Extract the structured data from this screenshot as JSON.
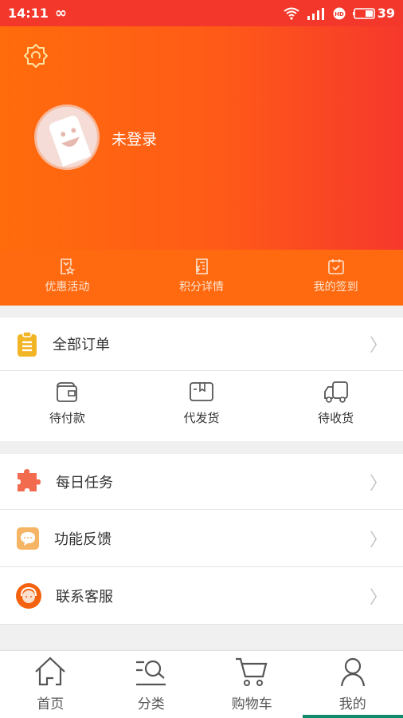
{
  "status_bar": {
    "time": "14:11",
    "battery": "39"
  },
  "profile": {
    "login_status": "未登录"
  },
  "quick_links": [
    {
      "label": "优惠活动",
      "icon": "coupon-icon"
    },
    {
      "label": "积分详情",
      "icon": "points-icon"
    },
    {
      "label": "我的签到",
      "icon": "checkin-icon"
    }
  ],
  "orders": {
    "all_label": "全部订单",
    "states": [
      {
        "label": "待付款",
        "icon": "wallet-icon"
      },
      {
        "label": "代发货",
        "icon": "box-icon"
      },
      {
        "label": "待收货",
        "icon": "truck-icon"
      }
    ]
  },
  "menu": [
    {
      "label": "每日任务",
      "icon": "puzzle-icon",
      "color": "#f26b4f"
    },
    {
      "label": "功能反馈",
      "icon": "feedback-icon",
      "color": "#f6b565"
    },
    {
      "label": "联系客服",
      "icon": "customer-service-icon",
      "color": "#f5620f"
    }
  ],
  "tabs": [
    {
      "label": "首页",
      "icon": "home-icon"
    },
    {
      "label": "分类",
      "icon": "category-icon"
    },
    {
      "label": "购物车",
      "icon": "cart-icon"
    },
    {
      "label": "我的",
      "icon": "user-icon",
      "active": true
    }
  ],
  "colors": {
    "header_start": "#ff6c0c",
    "header_end": "#f6382c",
    "accent_tab": "#138a6c"
  }
}
